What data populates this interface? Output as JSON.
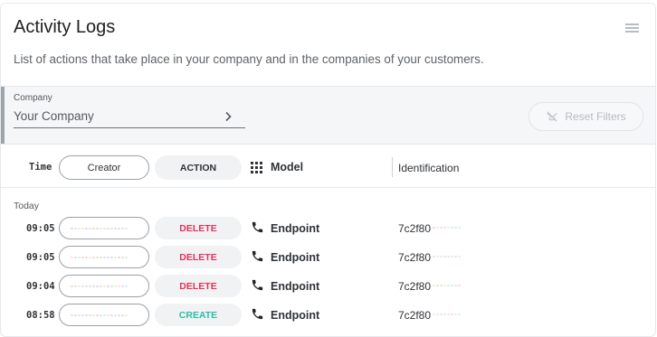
{
  "page": {
    "title": "Activity Logs",
    "subtitle": "List of actions that take place in your company and in the companies of your customers."
  },
  "filters": {
    "company_label": "Company",
    "company_value": "Your Company",
    "reset_label": "Reset Filters"
  },
  "columns": {
    "time": "Time",
    "creator": "Creator",
    "action": "ACTION",
    "model": "Model",
    "identification": "Identification"
  },
  "group": {
    "label": "Today"
  },
  "rows": [
    {
      "time": "09:05",
      "action": "DELETE",
      "action_color": "#e0345a",
      "model": "Endpoint",
      "id_prefix": "7c2f80"
    },
    {
      "time": "09:05",
      "action": "DELETE",
      "action_color": "#e0345a",
      "model": "Endpoint",
      "id_prefix": "7c2f80"
    },
    {
      "time": "09:04",
      "action": "DELETE",
      "action_color": "#e0345a",
      "model": "Endpoint",
      "id_prefix": "7c2f80"
    },
    {
      "time": "08:58",
      "action": "CREATE",
      "action_color": "#2bbfa4",
      "model": "Endpoint",
      "id_prefix": "7c2f80"
    }
  ],
  "colors": {
    "delete": "#e0345a",
    "create": "#2bbfa4",
    "muted": "#b6bbc0"
  },
  "icons": {
    "menu": "list-icon",
    "chevron": "chevron-right-icon",
    "reset": "filter-off-icon",
    "model": "grid-icon",
    "endpoint": "phone-icon"
  }
}
